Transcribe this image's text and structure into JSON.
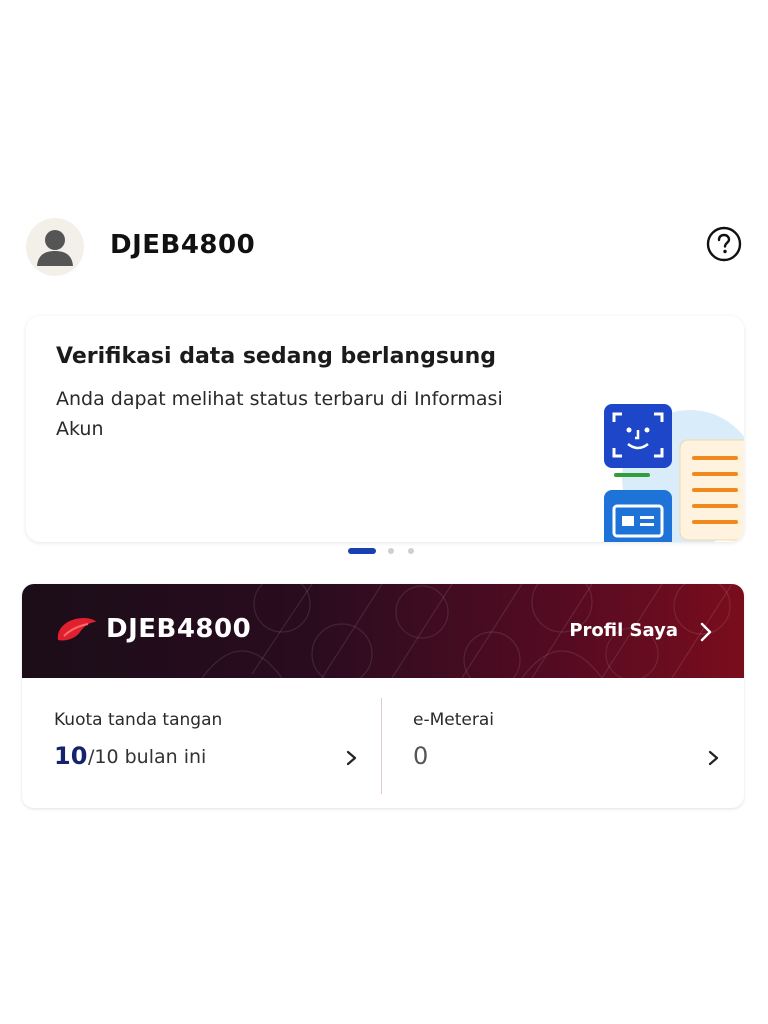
{
  "header": {
    "username": "DJEB4800",
    "avatar_icon": "user-avatar-icon",
    "help_icon": "help-circle-icon"
  },
  "banner": {
    "title": "Verifikasi data sedang berlangsung",
    "description": "Anda dapat melihat status terbaru di Informasi Akun",
    "illustration_icon": "face-id-document-illustration",
    "carousel": {
      "total": 3,
      "active_index": 0
    }
  },
  "profile_card": {
    "username": "DJEB4800",
    "brand_icon": "brand-logo-icon",
    "profile_link_label": "Profil Saya",
    "colors": {
      "header_start": "#1b0d18",
      "header_end": "#7a0d1d",
      "logo": "#e0202e"
    }
  },
  "stats": {
    "quota": {
      "label": "Kuota tanda tangan",
      "value": "10",
      "suffix": "/10 bulan ini"
    },
    "emeterai": {
      "label": "e-Meterai",
      "value": "0"
    }
  }
}
